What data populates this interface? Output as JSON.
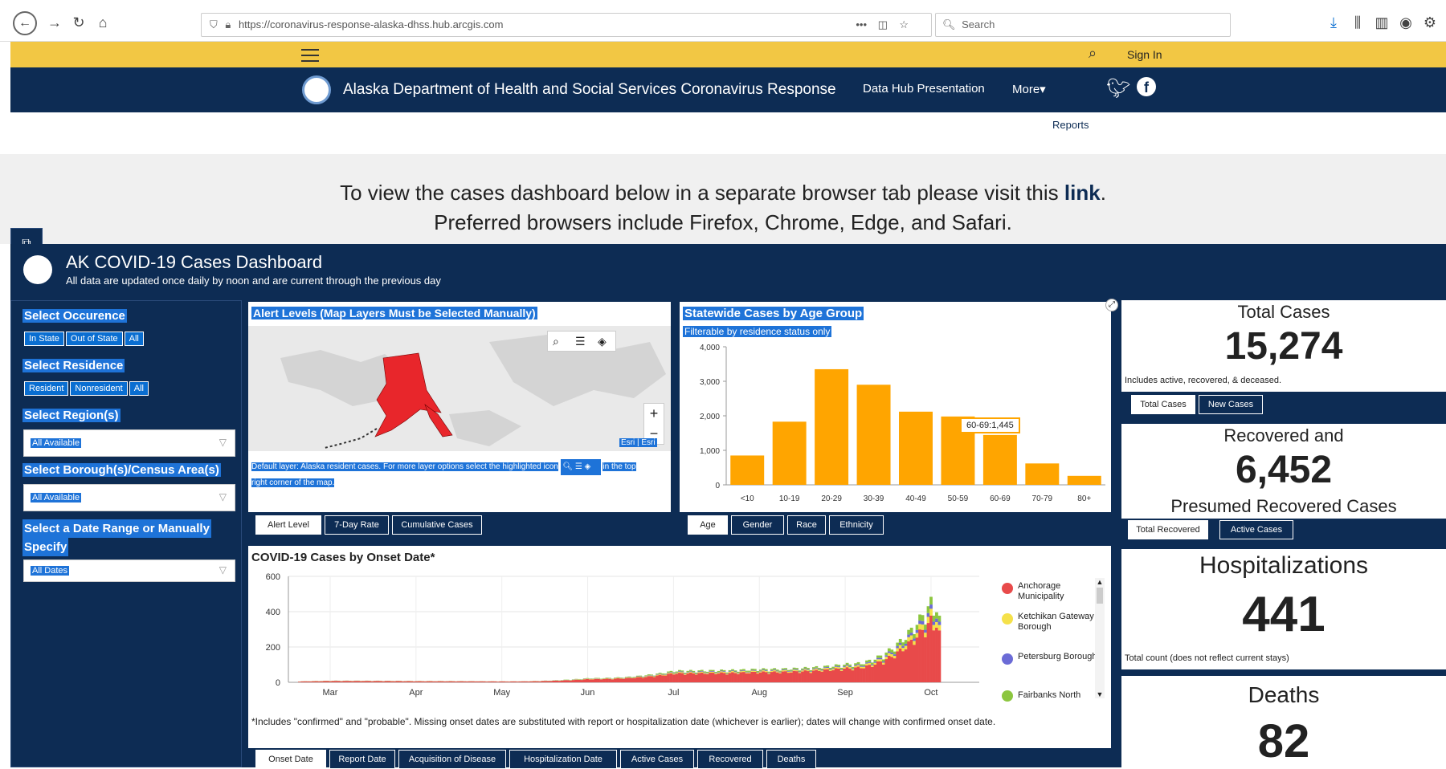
{
  "browser": {
    "url": "https://coronavirus-response-alaska-dhss.hub.arcgis.com",
    "search_placeholder": "Search",
    "dots": "•••"
  },
  "topbar": {
    "sign_in": "Sign In"
  },
  "site": {
    "title": "Alaska Department of Health and Social Services Coronavirus Response",
    "nav": [
      "Data Hub Presentation",
      "More▾"
    ]
  },
  "subnav": {
    "reports": "Reports"
  },
  "notice": {
    "line1": "To view the cases dashboard below in a separate browser tab please visit this ",
    "link": "link",
    "period": ".",
    "line2": "Preferred browsers include Firefox, Chrome, Edge, and Safari."
  },
  "dashboard": {
    "title": "AK COVID-19 Cases Dashboard",
    "subtitle": "All data are updated once daily by noon and are current through the previous day"
  },
  "filters": {
    "occurrence_title": "Select Occurence",
    "occurrence_options": [
      "In State",
      "Out of State",
      "All"
    ],
    "residence_title": "Select Residence",
    "residence_options": [
      "Resident",
      "Nonresident",
      "All"
    ],
    "region_title": "Select Region(s)",
    "region_value": "All Available",
    "borough_title": "Select Borough(s)/Census Area(s)",
    "borough_value": "All Available",
    "date_title_1": "Select a Date Range or Manually",
    "date_title_2": "Specify",
    "date_value": "All Dates"
  },
  "map": {
    "title": "Alert Levels (Map Layers Must be Selected Manually)",
    "attribution": "Esri | Esri",
    "caption_1": "Default layer: Alaska resident cases. For more layer options select the highlighted icon",
    "caption_2": "in the top",
    "caption_3": "right corner of the map.",
    "tabs": [
      "Alert Level",
      "7-Day Rate",
      "Cumulative Cases"
    ],
    "zoom_in": "+",
    "zoom_out": "−"
  },
  "age_chart": {
    "title": "Statewide Cases by Age Group",
    "subtitle": "Filterable by residence status only",
    "tooltip": "60-69:1,445",
    "tabs": [
      "Age",
      "Gender",
      "Race",
      "Ethnicity"
    ]
  },
  "chart_data": [
    {
      "type": "bar",
      "title": "Statewide Cases by Age Group",
      "categories": [
        "<10",
        "10-19",
        "20-29",
        "30-39",
        "40-49",
        "50-59",
        "60-69",
        "70-79",
        "80+"
      ],
      "values": [
        850,
        1830,
        3350,
        2900,
        2120,
        1980,
        1445,
        620,
        260
      ],
      "ylim": [
        0,
        4000
      ],
      "yticks": [
        0,
        1000,
        2000,
        3000,
        4000
      ],
      "ytick_labels": [
        "0",
        "1,000",
        "2,000",
        "3,000",
        "4,000"
      ],
      "color": "#ffa500"
    },
    {
      "type": "bar",
      "title": "COVID-19 Cases by Onset Date*",
      "stacked": true,
      "x_tick_labels": [
        "Mar",
        "Apr",
        "May",
        "Jun",
        "Jul",
        "Aug",
        "Sep",
        "Oct"
      ],
      "ylim": [
        0,
        600
      ],
      "yticks": [
        0,
        200,
        400,
        600
      ],
      "series": [
        {
          "name": "Anchorage Municipality",
          "color": "#e84a4a"
        },
        {
          "name": "Ketchikan Gateway Borough",
          "color": "#f5e14a"
        },
        {
          "name": "Petersburg Borough",
          "color": "#6b6bd6"
        },
        {
          "name": "Fairbanks North",
          "color": "#8cc63f"
        }
      ],
      "monthly_peak_totals": {
        "Mar": 10,
        "Apr": 8,
        "May": 6,
        "Jun": 25,
        "Jul": 70,
        "Aug": 80,
        "Sep": 110,
        "Oct": 500
      }
    }
  ],
  "onset_chart": {
    "title": "COVID-19 Cases by Onset Date*",
    "footnote": "*Includes \"confirmed\" and \"probable\". Missing onset dates are substituted with report or hospitalization date (whichever is earlier); dates will change with confirmed onset date.",
    "tabs": [
      "Onset Date",
      "Report Date",
      "Acquisition of Disease",
      "Hospitalization Date",
      "Active Cases",
      "Recovered",
      "Deaths"
    ]
  },
  "kpis": {
    "total_title": "Total Cases",
    "total_value": "15,274",
    "total_note": "Includes active, recovered, & deceased.",
    "total_tabs": [
      "Total Cases",
      "New Cases"
    ],
    "recovered_title_1": "Recovered and",
    "recovered_value": "6,452",
    "recovered_title_2": "Presumed Recovered Cases",
    "recovered_tabs": [
      "Total Recovered",
      "Active Cases"
    ],
    "hosp_title": "Hospitalizations",
    "hosp_value": "441",
    "hosp_note": "Total count (does not reflect current stays)",
    "deaths_title": "Deaths",
    "deaths_value": "82"
  }
}
